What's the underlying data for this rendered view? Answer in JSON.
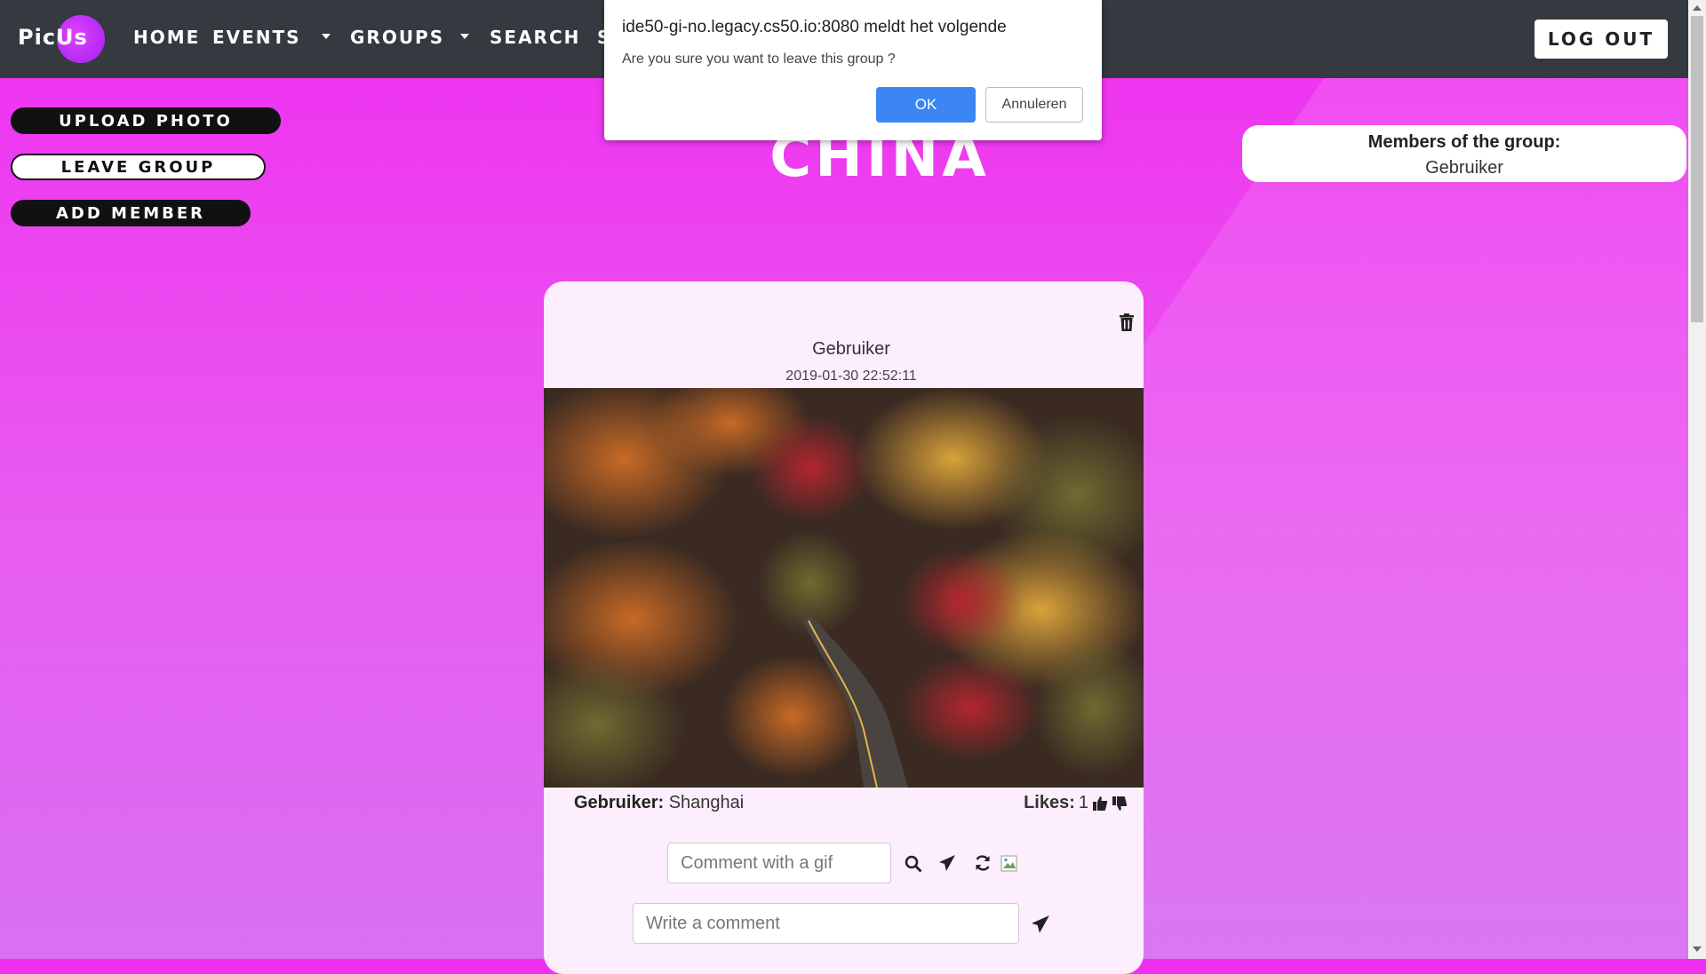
{
  "nav": {
    "logo": "PicUs",
    "items": [
      "HOME",
      "EVENTS",
      "GROUPS",
      "SEARCH"
    ],
    "partial_item": "S",
    "logout": "LOG OUT"
  },
  "actions": {
    "upload": "UPLOAD PHOTO",
    "leave": "LEAVE GROUP",
    "add": "ADD MEMBER"
  },
  "group": {
    "title": "CHINA"
  },
  "members": {
    "title": "Members of the group:",
    "names": [
      "Gebruiker"
    ]
  },
  "post": {
    "author": "Gebruiker",
    "date": "2019-01-30 22:52:11",
    "caption_user": "Gebruiker:",
    "caption_text": "Shanghai",
    "likes_label": "Likes:",
    "likes_count": "1",
    "gif_placeholder": "Comment with a gif",
    "comment_placeholder": "Write a comment"
  },
  "dialog": {
    "origin": "ide50-gi-no.legacy.cs50.io:8080 meldt het volgende",
    "message": "Are you sure you want to leave this group ?",
    "ok": "OK",
    "cancel": "Annuleren"
  },
  "colors": {
    "navbar": "#343a40",
    "background_top": "#f02ef0",
    "ok_button": "#3b86f2",
    "card": "#fdeefd"
  },
  "icons": [
    "trash-icon",
    "thumbs-up-icon",
    "thumbs-down-icon",
    "search-icon",
    "send-icon",
    "refresh-icon",
    "broken-image-icon"
  ]
}
